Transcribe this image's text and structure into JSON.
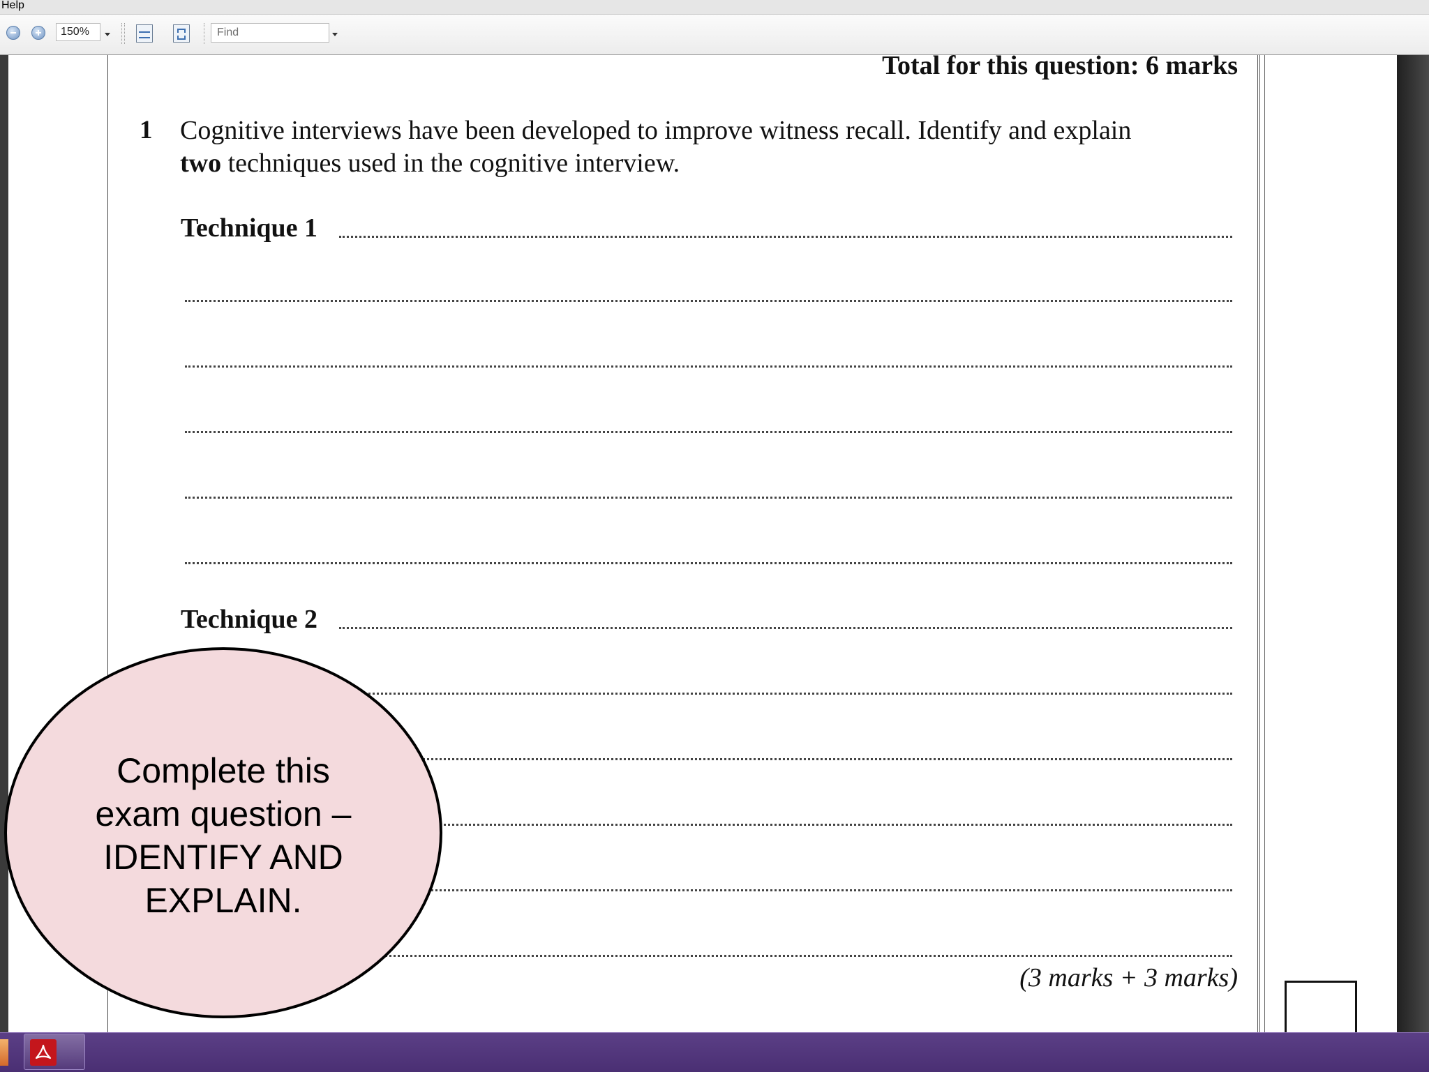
{
  "menubar": {
    "help_label": "Help"
  },
  "toolbar": {
    "zoom_value": "150%",
    "find_placeholder": "Find",
    "icons": [
      "zoom-out-icon",
      "zoom-in-icon",
      "fit-width-icon",
      "fit-page-icon"
    ]
  },
  "document": {
    "total_label": "Total for this question: 6 marks",
    "question_number": "1",
    "question_line1": "Cognitive interviews have been developed to improve witness recall.  Identify and explain",
    "question_line2_bold": "two",
    "question_line2_rest": " techniques used in the cognitive interview.",
    "technique1_label": "Technique 1",
    "technique2_label": "Technique 2",
    "marks_label": "(3 marks + 3 marks)"
  },
  "callout": {
    "text": "Complete this exam question – IDENTIFY AND EXPLAIN.",
    "fill_color": "#f4dadd"
  },
  "taskbar": {
    "color": "#4a2f73",
    "apps": [
      "adobe-reader-icon"
    ]
  }
}
